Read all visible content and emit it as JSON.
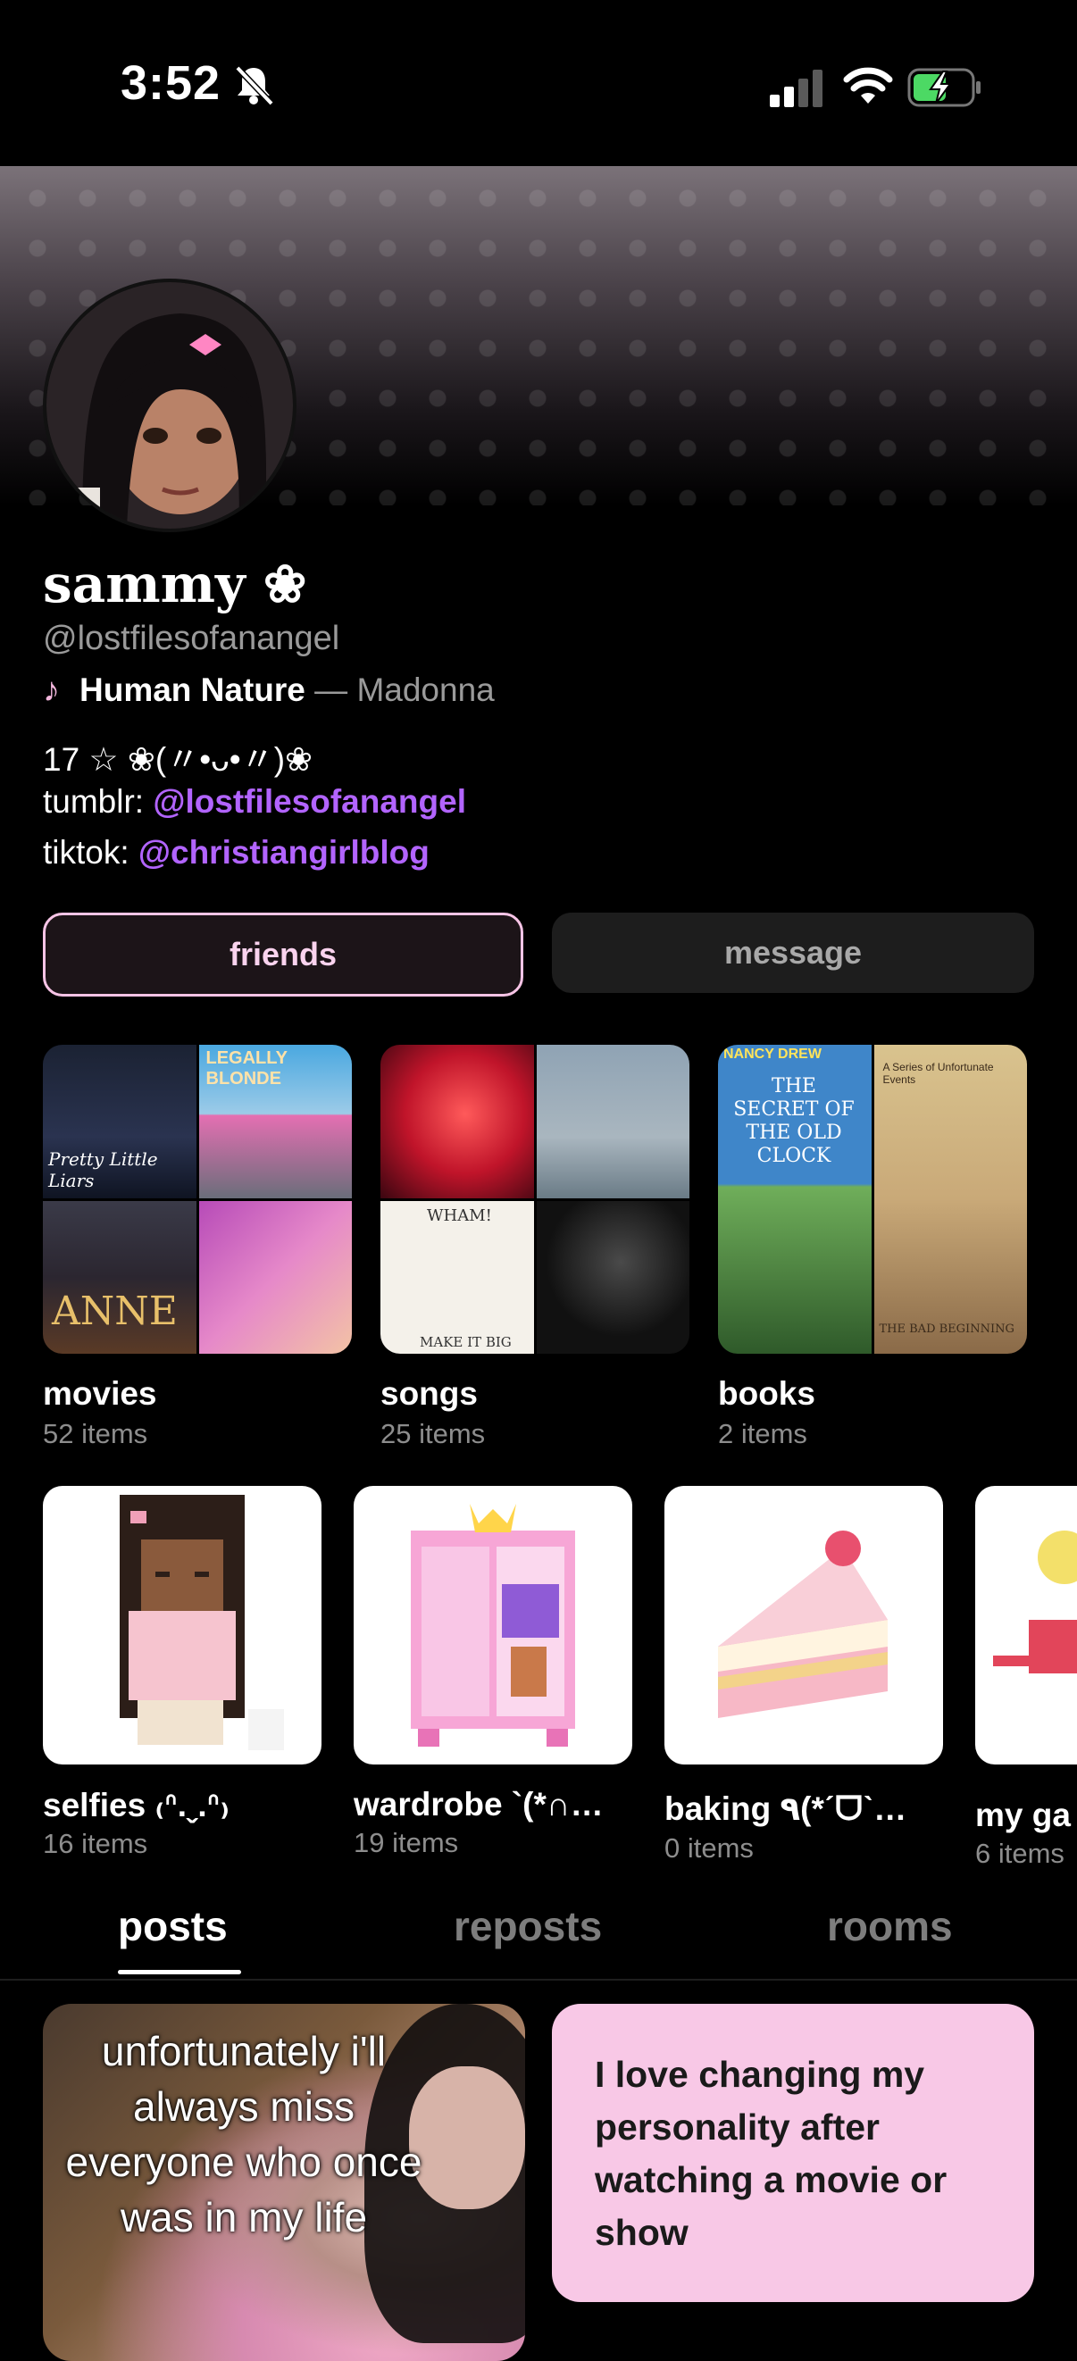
{
  "status_bar": {
    "time": "3:52"
  },
  "profile": {
    "display_name": "sammy ❀",
    "handle": "@lostfilesofanangel",
    "song": {
      "title": "Human Nature",
      "separator": " — ",
      "artist": "Madonna"
    },
    "bio": {
      "line1": "17 ☆ ❀(〃•ᴗ•〃)❀",
      "tumblr_label": "tumblr: ",
      "tumblr_handle": "@lostfilesofanangel",
      "tiktok_label": "tiktok: ",
      "tiktok_handle": "@christiangirlblog"
    }
  },
  "actions": {
    "friends": "friends",
    "message": "message"
  },
  "collections_row1": [
    {
      "title": "movies",
      "count": "52 items"
    },
    {
      "title": "songs",
      "count": "25 items"
    },
    {
      "title": "books",
      "count": "2 items"
    }
  ],
  "collection_covers": {
    "movie1": "Pretty Little Liars",
    "movie2": "LEGALLY BLONDE",
    "movie3": "ANNE",
    "song3": "WHAM!",
    "song3b": "MAKE IT BIG",
    "book1": "THE SECRET OF THE OLD CLOCK",
    "book1_series": "NANCY DREW",
    "book2": "THE BAD BEGINNING",
    "book2_series": "A Series of Unfortunate Events"
  },
  "collections_row2": [
    {
      "title": "selfies ₍ᐢ.ˬ.ᐢ₎",
      "count": "16 items"
    },
    {
      "title": "wardrobe `(*∩…",
      "count": "19 items"
    },
    {
      "title": "baking ٩(*ˊᗜˋ…",
      "count": "0 items"
    },
    {
      "title": "my ga",
      "count": "6 items"
    }
  ],
  "tabs": {
    "posts": "posts",
    "reposts": "reposts",
    "rooms": "rooms"
  },
  "posts": {
    "photo_caption": "unfortunately i'll always miss everyone who once was in my life",
    "text_post": "I love changing my personality after watching a movie or show"
  },
  "colors": {
    "accent_purple": "#b264ff",
    "accent_pink": "#f8c8e6",
    "background": "#000000"
  }
}
